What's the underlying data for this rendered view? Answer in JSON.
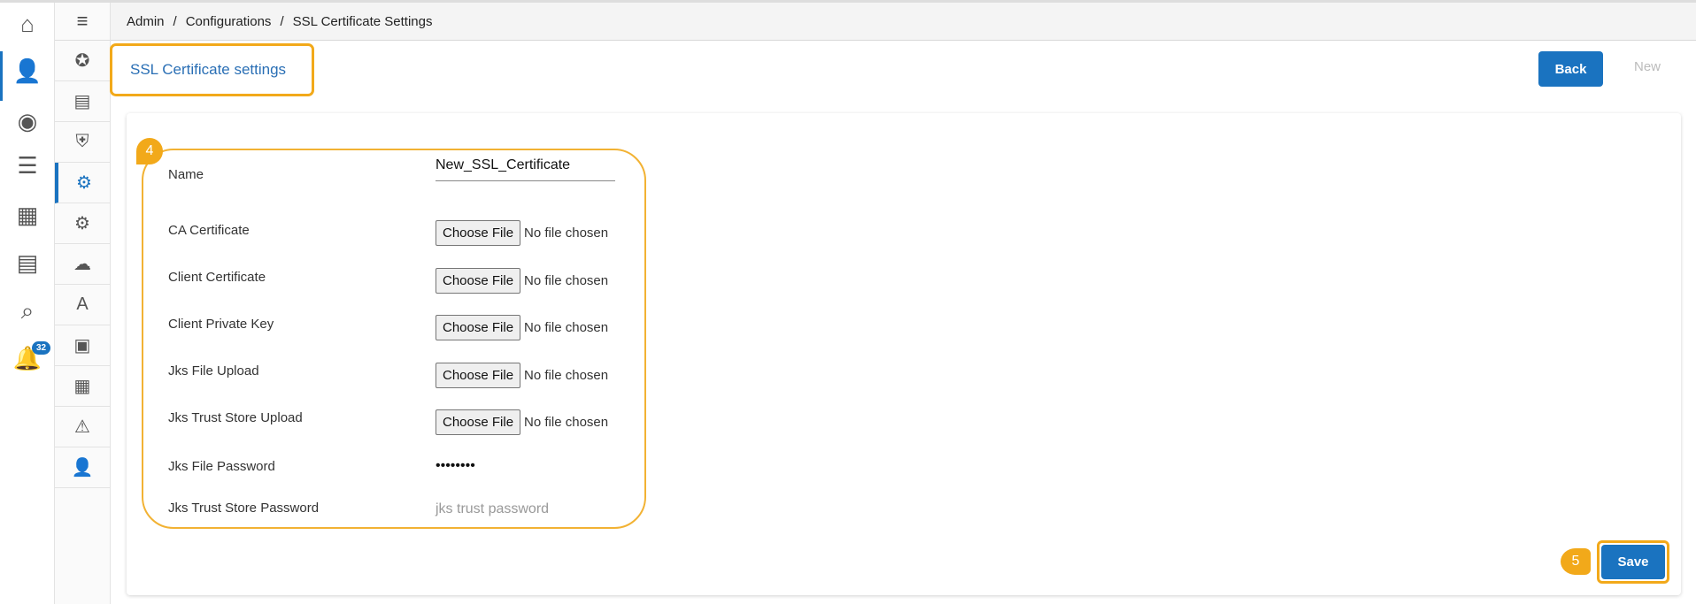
{
  "breadcrumb": [
    "Admin",
    "Configurations",
    "SSL Certificate Settings"
  ],
  "page_title": "SSL Certificate settings",
  "buttons": {
    "back": "Back",
    "new": "New",
    "save": "Save"
  },
  "notifications_count": "32",
  "annotations": {
    "form": "4",
    "save": "5"
  },
  "form": {
    "name_label": "Name",
    "name_value": "New_SSL_Certificate",
    "file_button": "Choose File",
    "no_file": "No file chosen",
    "files": [
      "CA Certificate",
      "Client Certificate",
      "Client Private Key",
      "Jks File Upload",
      "Jks Trust Store Upload"
    ],
    "jks_password_label": "Jks File Password",
    "jks_password_value": "••••••••",
    "trust_password_label": "Jks Trust Store Password",
    "trust_password_placeholder": "jks trust password"
  },
  "colors": {
    "accent": "#1a73c0",
    "highlight": "#f2a91a"
  }
}
